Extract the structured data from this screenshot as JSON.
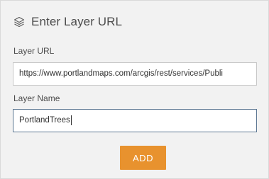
{
  "header": {
    "icon": "layers-icon",
    "title": "Enter Layer URL"
  },
  "form": {
    "url_label": "Layer URL",
    "url_value": "https://www.portlandmaps.com/arcgis/rest/services/Publi",
    "name_label": "Layer Name",
    "name_value": "PortlandTrees",
    "add_label": "ADD"
  },
  "colors": {
    "panel_bg": "#f2f2f2",
    "accent_button": "#e8922e",
    "focused_border": "#5d7893",
    "text": "#4c4c4c"
  }
}
